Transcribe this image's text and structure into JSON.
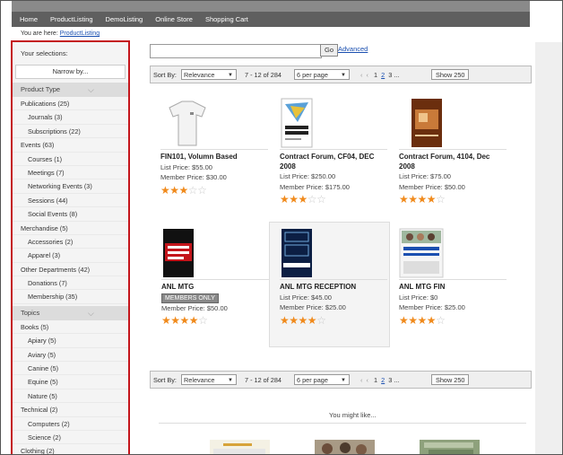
{
  "nav": [
    "Home",
    "ProductListing",
    "DemoListing",
    "Online Store",
    "Shopping Cart"
  ],
  "breadcrumb": {
    "prefix": "You are here:",
    "link": "ProductListing"
  },
  "sidebar": {
    "title": "Your selections:",
    "narrow_by": "Narrow by...",
    "facets": [
      {
        "heading": "Product Type",
        "items": [
          {
            "label": "Publications (25)",
            "level": 0
          },
          {
            "label": "Journals (3)",
            "level": 1
          },
          {
            "label": "Subscriptions (22)",
            "level": 1
          },
          {
            "label": "Events (63)",
            "level": 0
          },
          {
            "label": "Courses (1)",
            "level": 1
          },
          {
            "label": "Meetings (7)",
            "level": 1
          },
          {
            "label": "Networking Events (3)",
            "level": 1
          },
          {
            "label": "Sessions (44)",
            "level": 1
          },
          {
            "label": "Social Events (8)",
            "level": 1
          },
          {
            "label": "Merchandise (5)",
            "level": 0
          },
          {
            "label": "Accessories (2)",
            "level": 1
          },
          {
            "label": "Apparel (3)",
            "level": 1
          },
          {
            "label": "Other Departments (42)",
            "level": 0
          },
          {
            "label": "Donations (7)",
            "level": 1
          },
          {
            "label": "Membership (35)",
            "level": 1
          }
        ]
      },
      {
        "heading": "Topics",
        "items": [
          {
            "label": "Books (5)",
            "level": 0
          },
          {
            "label": "Apiary (5)",
            "level": 1
          },
          {
            "label": "Aviary (5)",
            "level": 1
          },
          {
            "label": "Canine (5)",
            "level": 1
          },
          {
            "label": "Equine (5)",
            "level": 1
          },
          {
            "label": "Nature (5)",
            "level": 1
          },
          {
            "label": "Technical (2)",
            "level": 0
          },
          {
            "label": "Computers (2)",
            "level": 1
          },
          {
            "label": "Science (2)",
            "level": 1
          },
          {
            "label": "Clothing (2)",
            "level": 0
          }
        ]
      }
    ]
  },
  "search": {
    "value": "",
    "go": "Go",
    "advanced": "Advanced"
  },
  "sortbar": {
    "sort_label": "Sort By:",
    "sort_value": "Relevance",
    "range": "7 - 12 of 284",
    "per_page": "6 per page",
    "pages": [
      "1",
      "2",
      "3"
    ],
    "ellipsis": "...",
    "show": "Show 250"
  },
  "products": [
    {
      "name": "FIN101, Volumn Based",
      "prices": [
        "List Price: $55.00",
        "Member Price: $30.00"
      ],
      "rating": 3
    },
    {
      "name": "Contract Forum, CF04, DEC 2008",
      "prices": [
        "List Price: $250.00",
        "Member Price: $175.00"
      ],
      "rating": 3
    },
    {
      "name": "Contract Forum, 4104, Dec 2008",
      "prices": [
        "List Price: $75.00",
        "Member Price: $50.00"
      ],
      "rating": 4
    },
    {
      "name": "ANL MTG",
      "badge": "MEMBERS ONLY",
      "prices": [
        "Member Price: $50.00"
      ],
      "rating": 4
    },
    {
      "name": "ANL MTG RECEPTION",
      "prices": [
        "List Price: $45.00",
        "Member Price: $25.00"
      ],
      "rating": 4
    },
    {
      "name": "ANL MTG FIN",
      "prices": [
        "List Price: $0",
        "Member Price: $25.00"
      ],
      "rating": 4
    }
  ],
  "might_like": "You might like...",
  "colors": {
    "accent": "#f08a1c",
    "sidebar_border": "#c4161c",
    "nav_bg": "#5f5f5f",
    "link": "#1a4fb0"
  }
}
